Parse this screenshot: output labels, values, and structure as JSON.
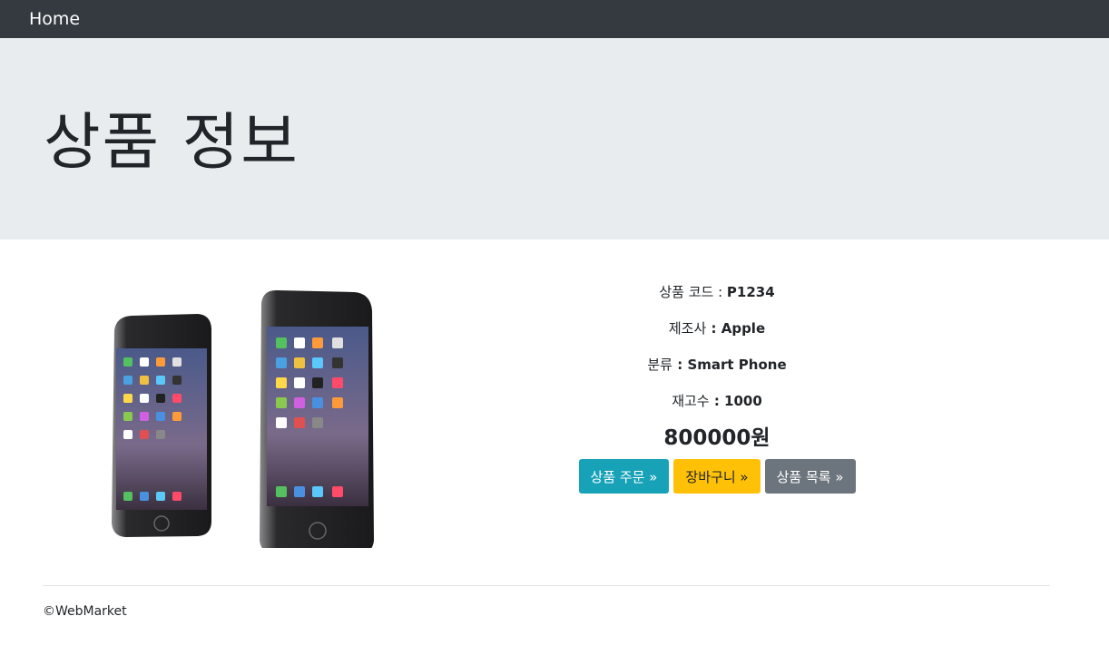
{
  "nav": {
    "brand": "Home"
  },
  "jumbotron": {
    "title": "상품 정보"
  },
  "product": {
    "image_label": "iphone-6-product-photo",
    "code_label": "상품 코드 : ",
    "code_value": "P1234",
    "manufacturer_label": "제조사",
    "manufacturer_sep": " : ",
    "manufacturer_value": "Apple",
    "category_label": "분류",
    "category_sep": " : ",
    "category_value": "Smart Phone",
    "stock_label": "재고수",
    "stock_sep": " : ",
    "stock_value": "1000",
    "price": "800000원"
  },
  "buttons": {
    "order": "상품 주문 »",
    "cart": "장바구니 »",
    "list": "상품 목록 »"
  },
  "footer": {
    "copyright": "©WebMarket"
  },
  "colors": {
    "navbar": "#343a40",
    "jumbotron": "#e9ecef",
    "order_button": "#17a2b8",
    "cart_button": "#ffc107",
    "list_button": "#6c757d"
  }
}
